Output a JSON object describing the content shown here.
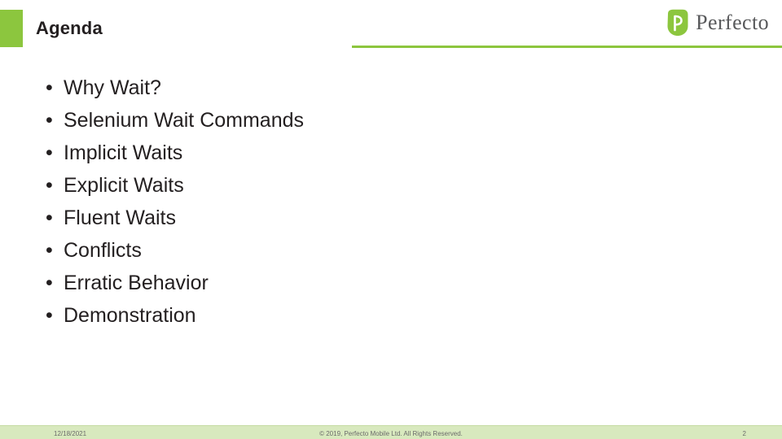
{
  "header": {
    "title": "Agenda",
    "accent_color": "#8CC63E",
    "rule_color": "#8CC63E"
  },
  "logo": {
    "name": "perfecto-logo",
    "wordmark": "Perfecto",
    "mark_color": "#8CC63E",
    "text_color": "#58595b"
  },
  "content": {
    "bullet_char": "•",
    "bullets": [
      {
        "text": "Why Wait?"
      },
      {
        "text": "Selenium Wait Commands"
      },
      {
        "text": "Implicit Waits"
      },
      {
        "text": "Explicit Waits"
      },
      {
        "text": "Fluent Waits"
      },
      {
        "text": "Conflicts"
      },
      {
        "text": "Erratic Behavior"
      },
      {
        "text": "Demonstration"
      }
    ]
  },
  "footer": {
    "date": "12/18/2021",
    "copyright": "© 2019, Perfecto Mobile Ltd. All Rights Reserved.",
    "page_number": "2",
    "bar_color": "#D8E9BE"
  }
}
